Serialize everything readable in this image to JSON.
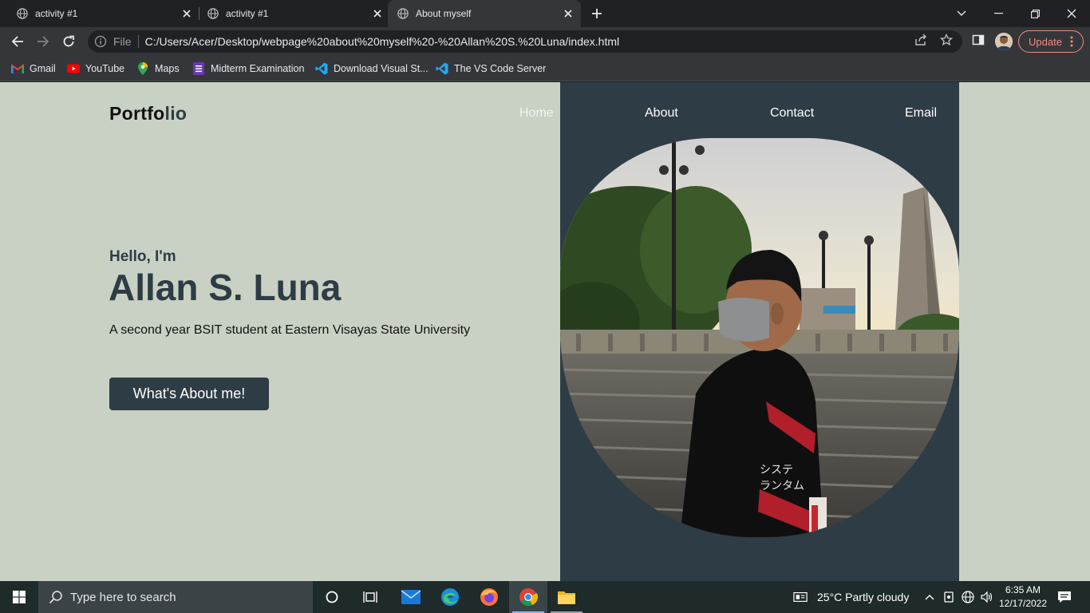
{
  "browser": {
    "tabs": [
      {
        "title": "activity #1",
        "active": false
      },
      {
        "title": "activity #1",
        "active": false
      },
      {
        "title": "About myself",
        "active": true
      }
    ],
    "omnibox": {
      "scheme_label": "File",
      "url": "C:/Users/Acer/Desktop/webpage%20about%20myself%20-%20Allan%20S.%20Luna/index.html"
    },
    "update_label": "Update",
    "bookmarks": [
      {
        "label": "Gmail",
        "icon": "gmail-icon"
      },
      {
        "label": "YouTube",
        "icon": "youtube-icon"
      },
      {
        "label": "Maps",
        "icon": "maps-icon"
      },
      {
        "label": "Midterm Examination",
        "icon": "forms-icon"
      },
      {
        "label": "Download Visual St...",
        "icon": "vscode-icon"
      },
      {
        "label": "The VS Code Server",
        "icon": "vscode-icon"
      }
    ]
  },
  "site": {
    "logo_main": "Portfo",
    "logo_accent": "lio",
    "nav": [
      "Home",
      "About",
      "Contact",
      "Email"
    ],
    "greeting": "Hello, I'm",
    "name": "Allan S. Luna",
    "tagline": "A second year BSIT student at Eastern Visayas State University",
    "cta_label": "What's About me!",
    "colors": {
      "background": "#c9d1c4",
      "panel": "#2e3c45",
      "accent": "#2e3c45"
    }
  },
  "taskbar": {
    "search_placeholder": "Type here to search",
    "weather": "25°C  Partly cloudy",
    "time": "6:35 AM",
    "date": "12/17/2022"
  }
}
